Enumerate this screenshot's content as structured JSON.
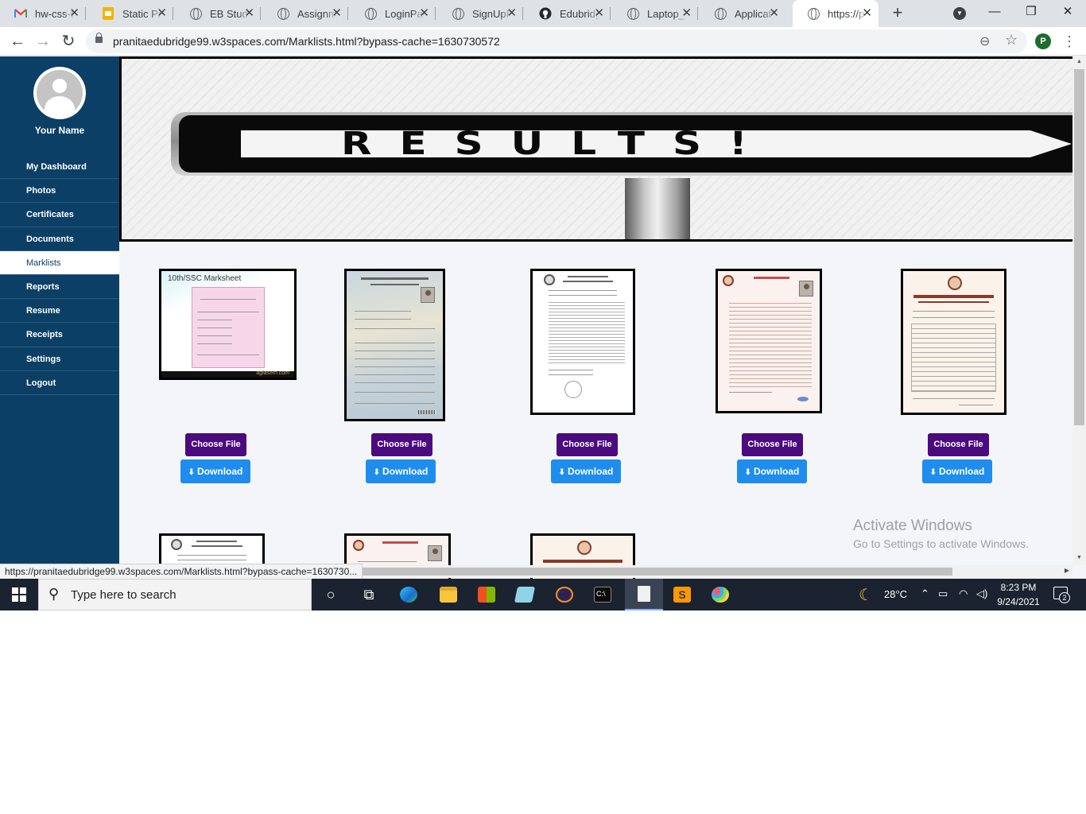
{
  "browser": {
    "tabs": [
      {
        "label": "hw-css-f",
        "icon": "gmail-icon"
      },
      {
        "label": "Static Pr",
        "icon": "slides-icon"
      },
      {
        "label": "EB Stude",
        "icon": "globe-icon"
      },
      {
        "label": "Assignm",
        "icon": "globe-icon"
      },
      {
        "label": "LoginPag",
        "icon": "globe-icon"
      },
      {
        "label": "SignUpP",
        "icon": "globe-icon"
      },
      {
        "label": "Edubridg",
        "icon": "github-icon"
      },
      {
        "label": "Laptop_V",
        "icon": "globe-icon"
      },
      {
        "label": "Applicat",
        "icon": "globe-icon"
      },
      {
        "label": "https://p",
        "icon": "globe-icon",
        "active": true
      }
    ],
    "url": "pranitaedubridge99.w3spaces.com/Marklists.html?bypass-cache=1630730572",
    "profile_initial": "P",
    "status_url": "https://pranitaedubridge99.w3spaces.com/Marklists.html?bypass-cache=1630730..."
  },
  "sidebar": {
    "user_name": "Your Name",
    "items": [
      {
        "label": "My Dashboard"
      },
      {
        "label": "Photos"
      },
      {
        "label": "Certificates"
      },
      {
        "label": "Documents"
      },
      {
        "label": "Marklists",
        "active": true
      },
      {
        "label": "Reports"
      },
      {
        "label": "Resume"
      },
      {
        "label": "Receipts"
      },
      {
        "label": "Settings"
      },
      {
        "label": "Logout"
      }
    ]
  },
  "banner": {
    "text": "RESULTS!"
  },
  "marksheets": {
    "first_caption": "10th/SSC Marksheet",
    "first_brand": "aglasem.com",
    "choose_label": "Choose File",
    "download_label": "Download"
  },
  "watermark": {
    "title": "Activate Windows",
    "subtitle": "Go to Settings to activate Windows."
  },
  "taskbar": {
    "search_placeholder": "Type here to search",
    "temperature": "28°C",
    "time": "8:23 PM",
    "date": "9/24/2021",
    "notification_count": "2"
  },
  "colors": {
    "sidebar_bg": "#0b3f66",
    "choose_button": "#4b0a7d",
    "download_button": "#1f8ded"
  }
}
